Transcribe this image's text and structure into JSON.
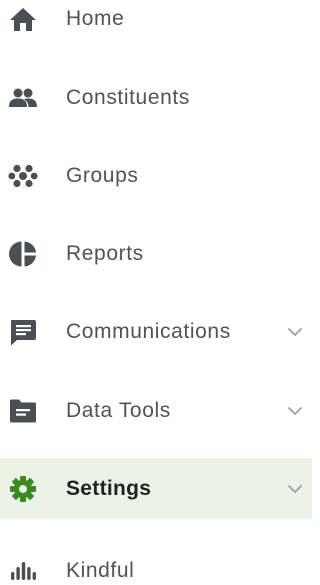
{
  "nav": {
    "items": [
      {
        "label": "Home",
        "icon": "home-icon",
        "active": false,
        "expandable": false
      },
      {
        "label": "Constituents",
        "icon": "people-icon",
        "active": false,
        "expandable": false
      },
      {
        "label": "Groups",
        "icon": "groups-icon",
        "active": false,
        "expandable": false
      },
      {
        "label": "Reports",
        "icon": "pie-chart-icon",
        "active": false,
        "expandable": false
      },
      {
        "label": "Communications",
        "icon": "chat-icon",
        "active": false,
        "expandable": true
      },
      {
        "label": "Data Tools",
        "icon": "folder-icon",
        "active": false,
        "expandable": true
      },
      {
        "label": "Settings",
        "icon": "gear-icon",
        "active": true,
        "expandable": true
      },
      {
        "label": "Kindful",
        "icon": "kindful-icon",
        "active": false,
        "expandable": false
      }
    ]
  },
  "colors": {
    "icon": "#4a4f53",
    "active_icon": "#3a8a1f",
    "active_background": "#eaf3e6",
    "text": "#4f5457",
    "active_text": "#1f2326",
    "chevron": "#9aa0a4"
  }
}
